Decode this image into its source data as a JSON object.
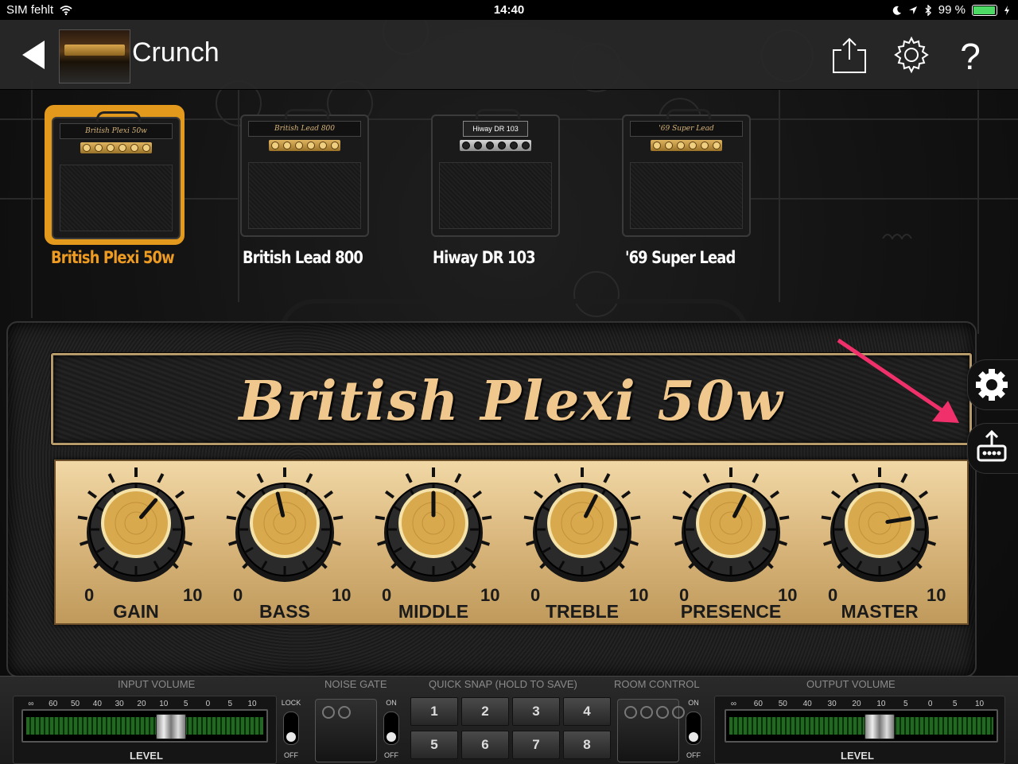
{
  "status_bar": {
    "carrier": "SIM fehlt",
    "time": "14:40",
    "battery": "99 %",
    "battery_level": 0.99
  },
  "nav": {
    "preset_name": "Crunch",
    "back_icon": "back-arrow-icon",
    "share_icon": "share-icon",
    "settings_icon": "gear-icon",
    "help_icon": "question-mark-icon"
  },
  "amp_selector": {
    "selected_index": 0,
    "amps": [
      {
        "name": "British Plexi 50w",
        "badge": "British Plexi 50w"
      },
      {
        "name": "British Lead 800",
        "badge": "British Lead 800"
      },
      {
        "name": "Hiway DR 103",
        "badge": "Hiway DR 103"
      },
      {
        "name": "'69 Super Lead",
        "badge": "'69 Super Lead"
      }
    ]
  },
  "amp": {
    "logo": "British Plexi 50w",
    "knobs": [
      {
        "name": "GAIN",
        "min": "0",
        "max": "10",
        "value": 6.5
      },
      {
        "name": "BASS",
        "min": "0",
        "max": "10",
        "value": 4.5
      },
      {
        "name": "MIDDLE",
        "min": "0",
        "max": "10",
        "value": 5.0
      },
      {
        "name": "TREBLE",
        "min": "0",
        "max": "10",
        "value": 6.0
      },
      {
        "name": "PRESENCE",
        "min": "0",
        "max": "10",
        "value": 6.0
      },
      {
        "name": "MASTER",
        "min": "0",
        "max": "10",
        "value": 8.0
      }
    ]
  },
  "side_buttons": {
    "settings_icon": "gear-icon",
    "export_icon": "export-amp-icon"
  },
  "bottom": {
    "input_volume": {
      "title": "INPUT VOLUME",
      "scale": [
        "∞",
        "60",
        "50",
        "40",
        "30",
        "20",
        "10",
        "5",
        "0",
        "5",
        "10"
      ],
      "label": "LEVEL",
      "level": 0.62,
      "lock_top": "LOCK",
      "lock_bottom": "OFF"
    },
    "noise_gate": {
      "title": "NOISE GATE",
      "on": "ON",
      "off": "OFF"
    },
    "quick_snap": {
      "title": "QUICK SNAP (HOLD TO SAVE)",
      "buttons": [
        "1",
        "2",
        "3",
        "4",
        "5",
        "6",
        "7",
        "8"
      ]
    },
    "room_control": {
      "title": "ROOM CONTROL",
      "on": "ON",
      "off": "OFF"
    },
    "output_volume": {
      "title": "OUTPUT VOLUME",
      "scale": [
        "∞",
        "60",
        "50",
        "40",
        "30",
        "20",
        "10",
        "5",
        "0",
        "5",
        "10"
      ],
      "label": "LEVEL",
      "level": 0.58
    }
  },
  "colors": {
    "accent": "#e39a1c",
    "knob_gold": "#d9a94e",
    "panel": "#e3c48c"
  }
}
